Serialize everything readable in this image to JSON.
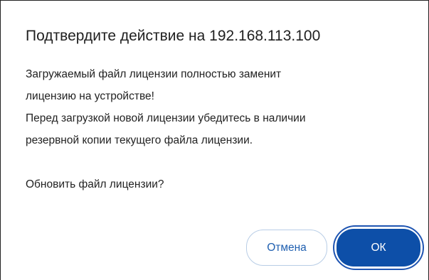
{
  "dialog": {
    "title": "Подтвердите действие на 192.168.113.100",
    "body_lines": [
      "Загружаемый файл лицензии полностью заменит",
      "лицензию на устройстве!",
      "Перед загрузкой новой лицензии убедитесь в наличии",
      "резервной копии текущего файла лицензии."
    ],
    "question": "Обновить файл лицензии?",
    "buttons": {
      "cancel_label": "Отмена",
      "ok_label": "ОК"
    }
  },
  "colors": {
    "primary": "#0d4fa8",
    "primary_border": "#1f55b2",
    "cancel_text": "#1f5fb0",
    "cancel_border": "#b8cde6"
  }
}
